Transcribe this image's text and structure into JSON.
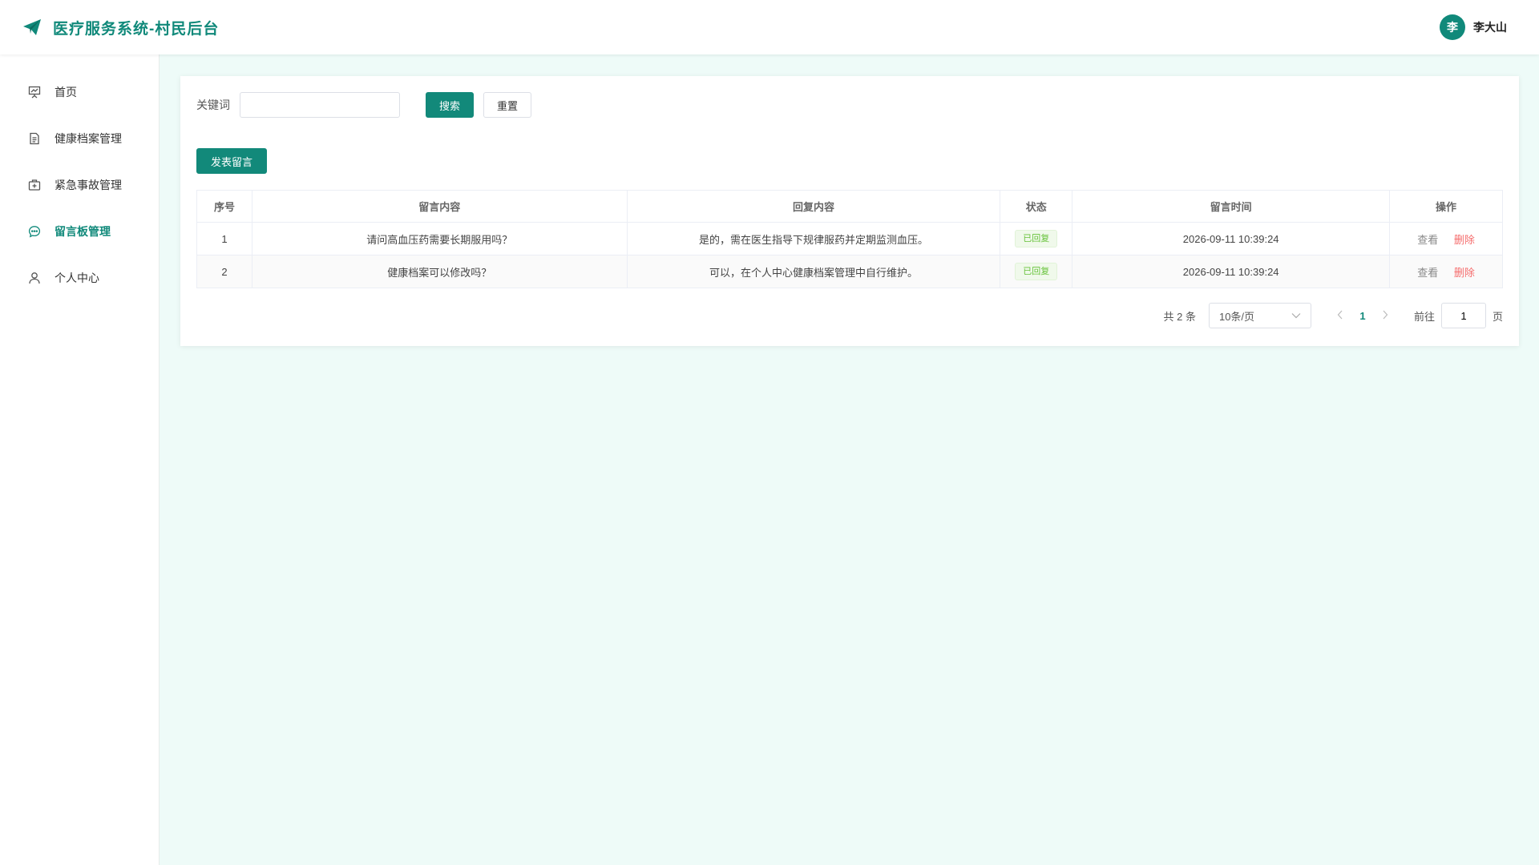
{
  "header": {
    "title": "医疗服务系统-村民后台",
    "avatar_text": "李",
    "username": "李大山"
  },
  "sidebar": {
    "items": [
      {
        "label": "首页",
        "icon": "presentation-board-icon"
      },
      {
        "label": "健康档案管理",
        "icon": "document-icon"
      },
      {
        "label": "紧急事故管理",
        "icon": "first-aid-kit-icon"
      },
      {
        "label": "留言板管理",
        "icon": "chat-bubble-icon",
        "active": true
      },
      {
        "label": "个人中心",
        "icon": "user-icon"
      }
    ]
  },
  "search": {
    "label": "关键词",
    "value": "",
    "placeholder": "",
    "search_button": "搜索",
    "reset_button": "重置"
  },
  "actions": {
    "post_button": "发表留言"
  },
  "table": {
    "headers": [
      "序号",
      "留言内容",
      "回复内容",
      "状态",
      "留言时间",
      "操作"
    ],
    "rows": [
      {
        "index": "1",
        "content": "请问高血压药需要长期服用吗？",
        "reply": "是的，需在医生指导下规律服药并定期监测血压。",
        "status": "已回复",
        "time": "2026-09-11 10:39:24",
        "view": "查看",
        "delete": "删除"
      },
      {
        "index": "2",
        "content": "健康档案可以修改吗？",
        "reply": "可以，在个人中心健康档案管理中自行维护。",
        "status": "已回复",
        "time": "2026-09-11 10:39:24",
        "view": "查看",
        "delete": "删除"
      }
    ]
  },
  "pagination": {
    "total": "共 2 条",
    "page_size": "10条/页",
    "current_page": "1",
    "goto_label": "前往",
    "goto_value": "1",
    "page_suffix": "页"
  },
  "colors": {
    "accent": "#10897a",
    "background": "#eefbf8",
    "status_success": "#67c23a",
    "danger": "#f56c6c"
  }
}
